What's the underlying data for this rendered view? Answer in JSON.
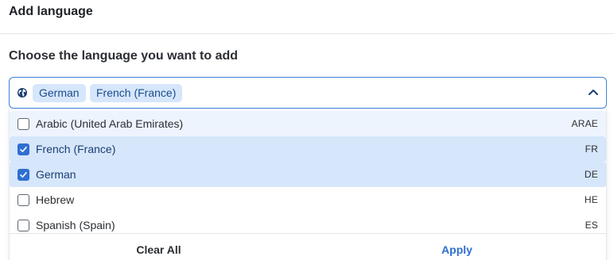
{
  "header": {
    "title": "Add language"
  },
  "field": {
    "label": "Choose the language you want to add",
    "selected_chips": [
      "German",
      "French (France)"
    ]
  },
  "options": [
    {
      "label": "Arabic (United Arab Emirates)",
      "code": "ARAE",
      "checked": false
    },
    {
      "label": "French (France)",
      "code": "FR",
      "checked": true
    },
    {
      "label": "German",
      "code": "DE",
      "checked": true
    },
    {
      "label": "Hebrew",
      "code": "HE",
      "checked": false
    },
    {
      "label": "Spanish (Spain)",
      "code": "ES",
      "checked": false
    }
  ],
  "footer": {
    "clear_label": "Clear All",
    "apply_label": "Apply"
  },
  "colors": {
    "accent": "#2f6fd1",
    "chip_bg": "#d6e6fb",
    "selected_row_bg": "#d6e6fb",
    "hover_row_bg": "#eef4fd",
    "focus_border": "#3b82d9"
  },
  "icons": {
    "field_icon": "globe-icon",
    "toggle_icon": "chevron-up-icon",
    "check_icon": "checkmark-icon"
  }
}
